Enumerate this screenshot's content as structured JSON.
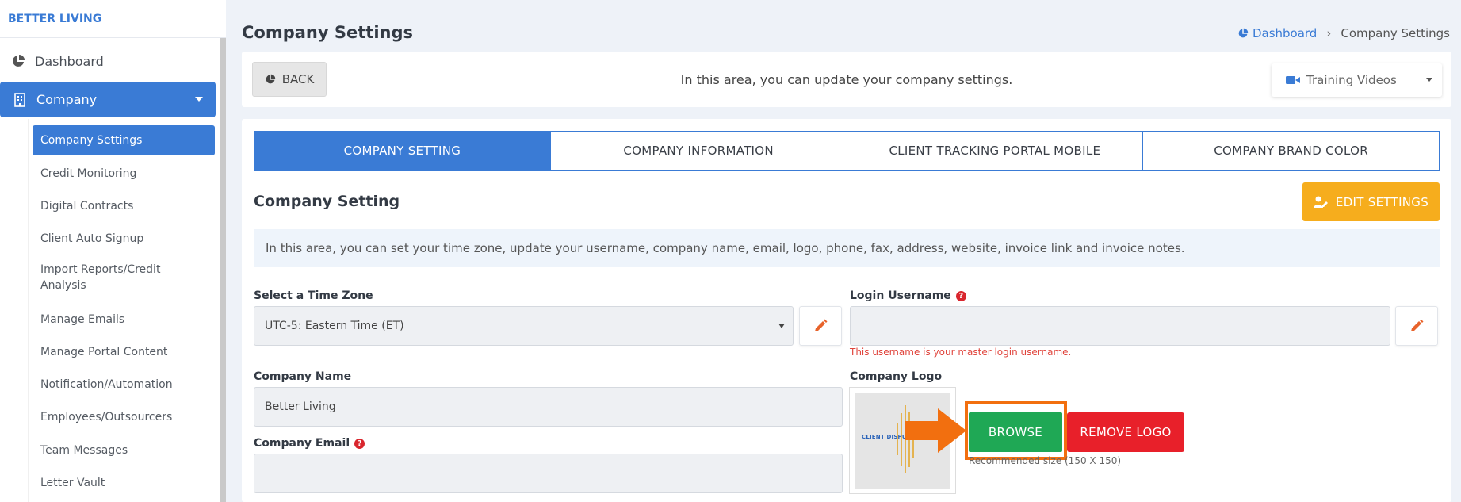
{
  "sidebar": {
    "brand": "BETTER LIVING",
    "dashboard_label": "Dashboard",
    "company_label": "Company",
    "submenu": [
      "Company Settings",
      "Credit Monitoring",
      "Digital Contracts",
      "Client Auto Signup",
      "Import Reports/Credit Analysis",
      "Manage Emails",
      "Manage Portal Content",
      "Notification/Automation",
      "Employees/Outsourcers",
      "Team Messages",
      "Letter Vault"
    ]
  },
  "header": {
    "title": "Company Settings",
    "breadcrumb_home": "Dashboard",
    "breadcrumb_current": "Company Settings"
  },
  "topbar": {
    "back_label": "BACK",
    "info": "In this area, you can update your company settings.",
    "training_label": "Training Videos"
  },
  "tabs": [
    "COMPANY SETTING",
    "COMPANY INFORMATION",
    "CLIENT TRACKING PORTAL MOBILE",
    "COMPANY BRAND COLOR"
  ],
  "section": {
    "title": "Company Setting",
    "edit_label": "EDIT SETTINGS",
    "info": "In this area, you can set your time zone, update your username, company name, email, logo, phone, fax, address, website, invoice link and invoice notes."
  },
  "form": {
    "timezone_label": "Select a Time Zone",
    "timezone_value": "UTC-5: Eastern Time (ET)",
    "username_label": "Login Username",
    "username_value": "",
    "username_hint": "This username is your master login username.",
    "company_name_label": "Company Name",
    "company_name_value": "Better Living",
    "company_email_label": "Company Email",
    "company_email_value": "",
    "logo_label": "Company Logo",
    "logo_text": "CLIENT DISPUTE",
    "browse_label": "BROWSE",
    "remove_label": "REMOVE LOGO",
    "logo_hint": "Recommended size (150 X 150)"
  },
  "colors": {
    "primary": "#3a7bd5",
    "warning": "#f6ad1d",
    "success": "#1fa855",
    "danger": "#e8202a",
    "highlight": "#f26f0f"
  }
}
